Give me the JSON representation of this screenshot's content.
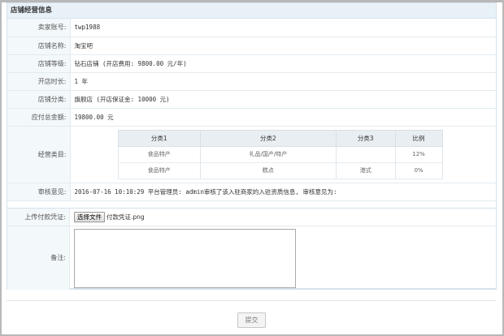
{
  "panel_title": "店铺经营信息",
  "fields": {
    "seller_account": {
      "label": "卖家账号:",
      "value": "twp1988"
    },
    "shop_name": {
      "label": "店铺名称:",
      "value": "淘宝吧"
    },
    "shop_level": {
      "label": "店铺等级:",
      "value": "钻石店铺 (开店费用: 9800.00 元/年)"
    },
    "shop_duration": {
      "label": "开店时长:",
      "value": "1 年"
    },
    "shop_category": {
      "label": "店铺分类:",
      "value": "旗舰店 (开店保证金: 10000 元)"
    },
    "total_amount": {
      "label": "应付总金额:",
      "value": "19800.00 元"
    },
    "business_category": {
      "label": "经营类目:"
    },
    "audit_opinion": {
      "label": "审核意见:",
      "value": "2016-07-16 10:10:29 平台管理员: admin审核了该入驻商家的入驻资质信息, 审核意见为:"
    }
  },
  "category_table": {
    "headers": [
      "分类1",
      "分类2",
      "分类3",
      "比例"
    ],
    "rows": [
      [
        "食品特产",
        "礼品/国产/特产",
        "",
        "12%"
      ],
      [
        "食品特产",
        "糕点",
        "港式",
        "0%"
      ]
    ]
  },
  "upload": {
    "label": "上传付款凭证:",
    "button": "选择文件",
    "file_name": "付款凭证.png"
  },
  "remark": {
    "label": "备注:",
    "value": ""
  },
  "submit_label": "提交"
}
